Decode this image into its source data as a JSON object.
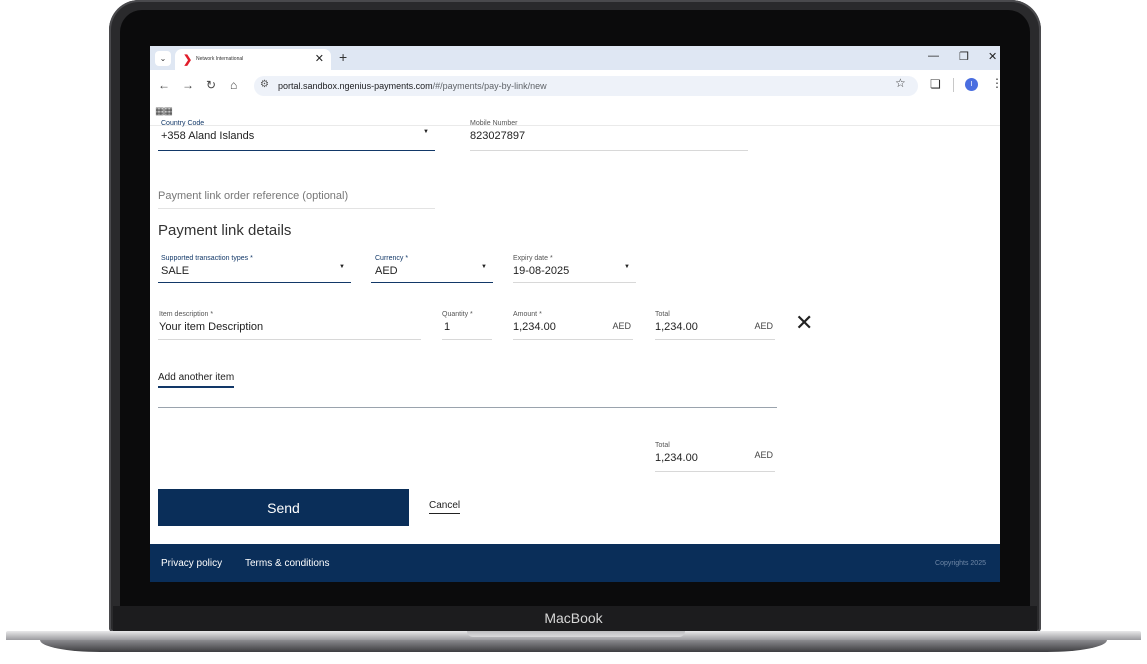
{
  "device": {
    "brand": "MacBook"
  },
  "browser": {
    "tab_title": "Network International",
    "url_host": "portal.sandbox.ngenius-payments.com",
    "url_path": "/#/payments/pay-by-link/new",
    "avatar_letter": "I"
  },
  "contact": {
    "country_code_label": "Country Code",
    "country_code_value": "+358 Aland Islands",
    "mobile_label": "Mobile Number",
    "mobile_value": "823027897"
  },
  "order_reference_placeholder": "Payment link order reference (optional)",
  "details": {
    "title": "Payment link details",
    "transaction_types_label": "Supported transaction types *",
    "transaction_types_value": "SALE",
    "currency_label": "Currency *",
    "currency_value": "AED",
    "expiry_label": "Expiry date *",
    "expiry_value": "19-08-2025"
  },
  "item": {
    "description_label": "Item description *",
    "description_value": "Your item Description",
    "quantity_label": "Quantity *",
    "quantity_value": "1",
    "amount_label": "Amount *",
    "amount_value": "1,234.00",
    "amount_currency": "AED",
    "total_label": "Total",
    "total_value": "1,234.00",
    "total_currency": "AED"
  },
  "add_item_label": "Add another item",
  "grand_total": {
    "label": "Total",
    "value": "1,234.00",
    "currency": "AED"
  },
  "actions": {
    "send_label": "Send",
    "cancel_label": "Cancel"
  },
  "footer": {
    "privacy_label": "Privacy policy",
    "terms_label": "Terms & conditions",
    "copyright": "Copyrights 2025"
  },
  "colors": {
    "brand_navy": "#0a2e59",
    "accent_red": "#e11d2a"
  }
}
